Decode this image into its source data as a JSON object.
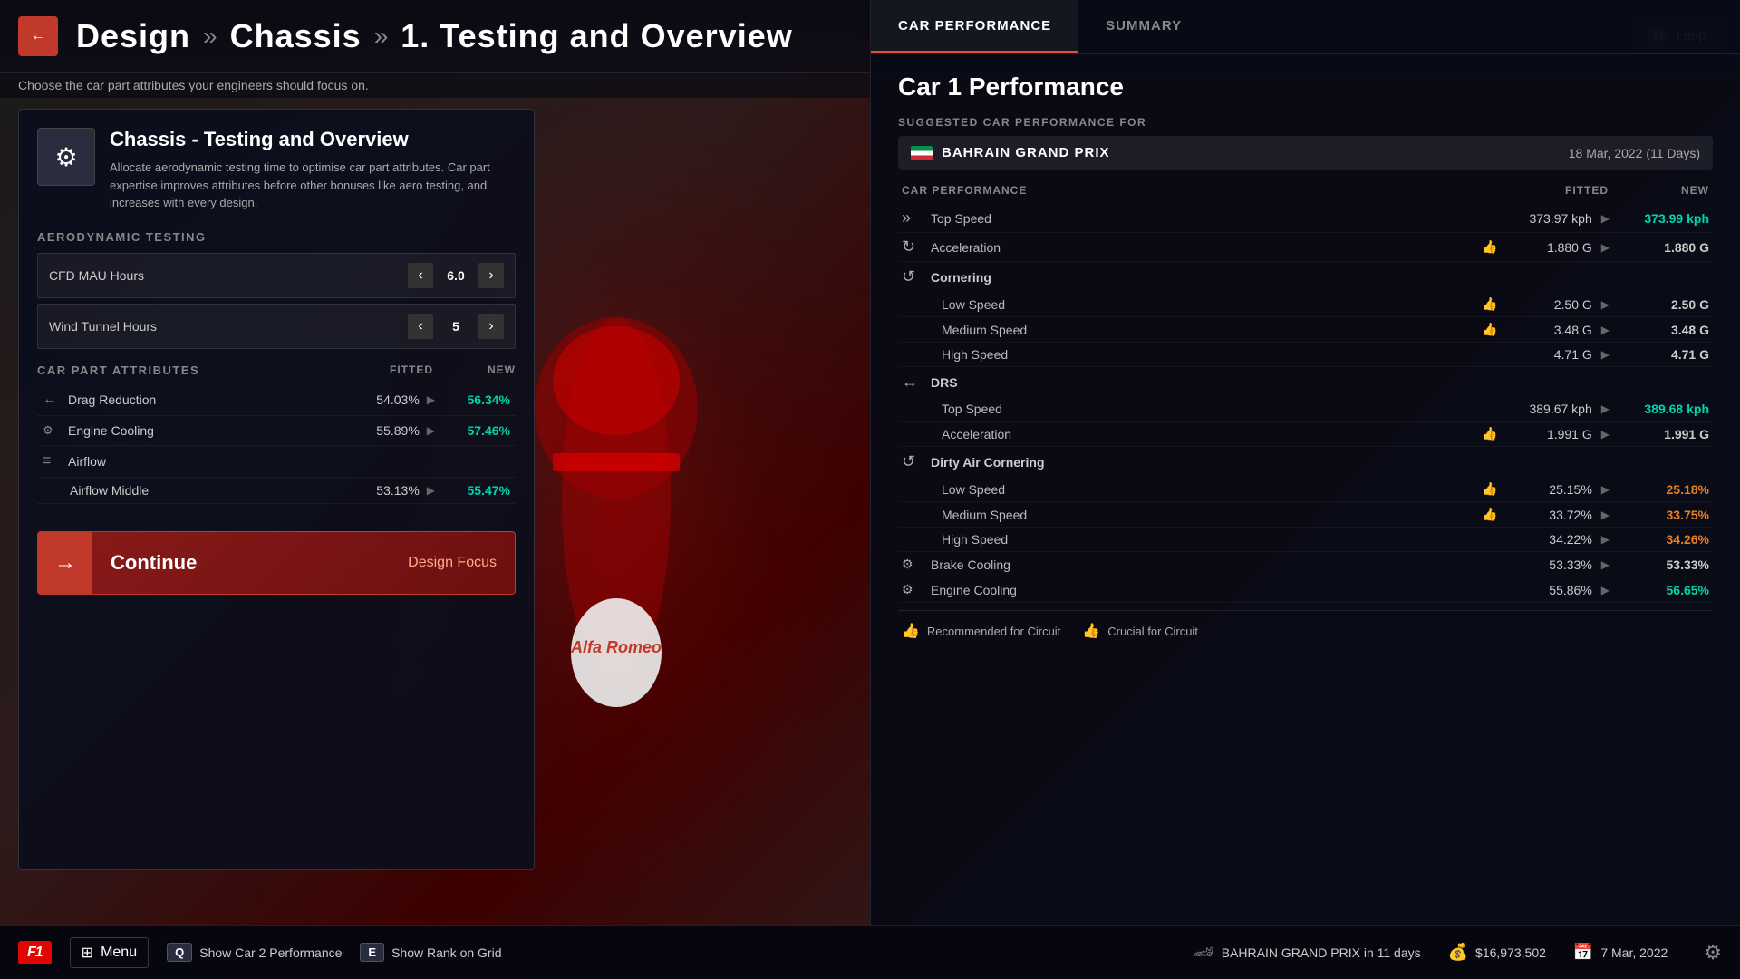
{
  "header": {
    "back_label": "←",
    "breadcrumb": {
      "design": "Design",
      "sep1": "»",
      "chassis": "Chassis",
      "sep2": "»",
      "section": "1. Testing and Overview"
    },
    "subtitle": "Choose the car part attributes your engineers should focus on.",
    "help_key": "H",
    "help_label": "Help"
  },
  "left_panel": {
    "icon": "⚙",
    "title": "Chassis - Testing and Overview",
    "description": "Allocate aerodynamic testing time to optimise car part attributes. Car part expertise improves attributes before other bonuses like aero testing, and increases with every design.",
    "aero_section": "AERODYNAMIC TESTING",
    "sliders": [
      {
        "id": "cfd",
        "label": "CFD MAU Hours",
        "value": "6.0"
      },
      {
        "id": "wind",
        "label": "Wind Tunnel Hours",
        "value": "5"
      }
    ],
    "attrs_section": "CAR PART ATTRIBUTES",
    "fitted_col": "FITTED",
    "new_col": "NEW",
    "attributes": [
      {
        "id": "drag",
        "icon": "←",
        "name": "Drag Reduction",
        "fitted": "54.03%",
        "arrow": "▶",
        "new": "56.34%",
        "positive": true
      },
      {
        "id": "engine_cool",
        "icon": "⚙",
        "name": "Engine Cooling",
        "fitted": "55.89%",
        "arrow": "▶",
        "new": "57.46%",
        "positive": true
      },
      {
        "id": "airflow",
        "icon": "≡",
        "name": "Airflow",
        "fitted": "",
        "arrow": "",
        "new": "",
        "positive": false
      },
      {
        "id": "airflow_mid",
        "icon": "",
        "name": "Airflow Middle",
        "fitted": "53.13%",
        "arrow": "▶",
        "new": "55.47%",
        "positive": true,
        "indent": true
      }
    ],
    "continue_label": "Continue",
    "continue_sub": "Design Focus"
  },
  "right_panel": {
    "tabs": [
      {
        "id": "car_performance",
        "label": "CAR PERFORMANCE",
        "active": true
      },
      {
        "id": "summary",
        "label": "SUMMARY",
        "active": false
      }
    ],
    "car_perf_title": "Car 1 Performance",
    "suggested_label": "SUGGESTED CAR PERFORMANCE FOR",
    "grand_prix": "BAHRAIN GRAND PRIX",
    "gp_date": "18 Mar, 2022 (11 Days)",
    "perf_table": {
      "fitted_col": "FITTED",
      "new_col": "NEW",
      "sections": [
        {
          "id": "top_speed",
          "icon": "»",
          "label": "Top Speed",
          "fitted": "373.97 kph",
          "new": "373.99 kph",
          "new_class": "better",
          "rows": []
        },
        {
          "id": "acceleration",
          "icon": "↻",
          "label": "Acceleration",
          "thumb": true,
          "fitted": "1.880 G",
          "new": "1.880 G",
          "new_class": "same",
          "rows": []
        },
        {
          "id": "cornering",
          "icon": "↺",
          "label": "Cornering",
          "fitted": "",
          "new": "",
          "rows": [
            {
              "id": "low_speed",
              "name": "Low Speed",
              "thumb": true,
              "fitted": "2.50 G",
              "new": "2.50 G",
              "new_class": "same"
            },
            {
              "id": "med_speed",
              "name": "Medium Speed",
              "thumb": true,
              "fitted": "3.48 G",
              "new": "3.48 G",
              "new_class": "same"
            },
            {
              "id": "high_speed",
              "name": "High Speed",
              "fitted": "4.71 G",
              "new": "4.71 G",
              "new_class": "same"
            }
          ]
        },
        {
          "id": "drs",
          "icon": "↔",
          "label": "DRS",
          "fitted": "",
          "new": "",
          "rows": [
            {
              "id": "drs_top",
              "name": "Top Speed",
              "fitted": "389.67 kph",
              "new": "389.68 kph",
              "new_class": "better"
            },
            {
              "id": "drs_accel",
              "name": "Acceleration",
              "thumb": true,
              "fitted": "1.991 G",
              "new": "1.991 G",
              "new_class": "same"
            }
          ]
        },
        {
          "id": "dirty_air",
          "icon": "↺",
          "label": "Dirty Air Cornering",
          "fitted": "",
          "new": "",
          "rows": [
            {
              "id": "da_low",
              "name": "Low Speed",
              "thumb": true,
              "fitted": "25.15%",
              "new": "25.18%",
              "new_class": "dirty"
            },
            {
              "id": "da_med",
              "name": "Medium Speed",
              "thumb": true,
              "fitted": "33.72%",
              "new": "33.75%",
              "new_class": "dirty"
            },
            {
              "id": "da_high",
              "name": "High Speed",
              "fitted": "34.22%",
              "new": "34.26%",
              "new_class": "dirty"
            }
          ]
        },
        {
          "id": "brake_cool",
          "icon": "⚙",
          "label": "Brake Cooling",
          "fitted": "53.33%",
          "new": "53.33%",
          "new_class": "same",
          "rows": []
        },
        {
          "id": "engine_cool2",
          "icon": "⚙",
          "label": "Engine Cooling",
          "fitted": "55.86%",
          "new": "56.65%",
          "new_class": "better",
          "rows": []
        }
      ]
    },
    "legend": [
      {
        "id": "recommended",
        "icon": "👍",
        "label": "Recommended for Circuit"
      },
      {
        "id": "crucial",
        "icon": "👍",
        "label": "Crucial for Circuit"
      }
    ]
  },
  "bottom_bar": {
    "f1_label": "F1",
    "menu_icon": "⊞",
    "menu_label": "Menu",
    "shortcuts": [
      {
        "id": "car2",
        "key": "Q",
        "label": "Show Car 2 Performance"
      },
      {
        "id": "grid",
        "key": "E",
        "label": "Show Rank on Grid"
      }
    ],
    "gp_info": "BAHRAIN GRAND PRIX in 11 days",
    "money": "$16,973,502",
    "date": "7 Mar, 2022",
    "settings_icon": "⚙"
  }
}
